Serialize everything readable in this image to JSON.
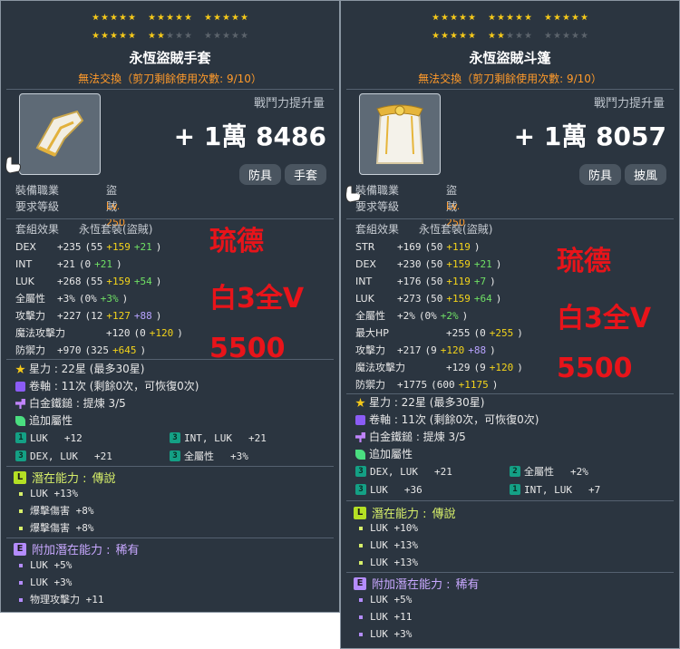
{
  "left": {
    "stars_on_row1": 15,
    "stars_on_row2": 7,
    "title": "永恆盜賊手套",
    "trade_note": "無法交換（剪刀剩餘使用次數: 9/10）",
    "power_label": "戰鬥力提升量",
    "power_value": "+ 1萬 8486",
    "tags": [
      "防具",
      "手套"
    ],
    "job_label": "裝備職業",
    "job_value": "盜賊",
    "level_label": "要求等級",
    "level_value": "Lv. 250",
    "set_label": "套組效果",
    "set_name": "永恆套裝(盜賊)",
    "stats": [
      {
        "name": "DEX",
        "base": "+235",
        "detail": "(55",
        "yel": "+159",
        "grn": "+21",
        "close": ")",
        "pur": ""
      },
      {
        "name": "INT",
        "base": "+21",
        "detail": "(0",
        "yel": "",
        "grn": "+21",
        "close": ")",
        "pur": ""
      },
      {
        "name": "LUK",
        "base": "+268",
        "detail": "(55",
        "yel": "+159",
        "grn": "+54",
        "close": ")",
        "pur": ""
      },
      {
        "name": "全屬性",
        "base": "+3%",
        "detail": "(0%",
        "yel": "",
        "grn": "+3%",
        "close": ")",
        "pur": ""
      },
      {
        "name": "攻擊力",
        "base": "+227",
        "detail": "(12",
        "yel": "+127",
        "grn": "",
        "close": ")",
        "pur": "+88"
      },
      {
        "name": "魔法攻擊力",
        "base": "+120",
        "detail": "(0",
        "yel": "+120",
        "grn": "",
        "close": ")",
        "pur": ""
      },
      {
        "name": "防禦力",
        "base": "+970",
        "detail": "(325",
        "yel": "+645",
        "grn": "",
        "close": ")",
        "pur": ""
      }
    ],
    "overlay": [
      "琉德",
      "白3全V",
      "5500"
    ],
    "star_force": "星力 : 22星 (最多30星)",
    "scroll": "卷軸 : 11次 (剩餘0次，可恢復0次)",
    "hammer": "白金鐵鎚 : 提煉 3/5",
    "flame_title": "追加屬性",
    "flames": [
      {
        "stat": "LUK",
        "val": "+12"
      },
      {
        "stat": "INT, LUK",
        "val": "+21"
      },
      {
        "stat": "DEX, LUK",
        "val": "+21"
      },
      {
        "stat": "全屬性",
        "val": "+3%"
      }
    ],
    "potential_label": "潛在能力 : ",
    "potential_grade": "傳說",
    "potential": [
      "LUK +13%",
      "爆擊傷害 +8%",
      "爆擊傷害 +8%"
    ],
    "bonus_label": "附加潛在能力 : ",
    "bonus_grade": "稀有",
    "bonus": [
      "LUK +5%",
      "LUK +3%",
      "物理攻擊力 +11"
    ],
    "icon_name": "glove-icon"
  },
  "right": {
    "stars_on_row1": 15,
    "stars_on_row2": 7,
    "title": "永恆盜賊斗篷",
    "trade_note": "無法交換（剪刀剩餘使用次數: 9/10）",
    "power_label": "戰鬥力提升量",
    "power_value": "+ 1萬 8057",
    "tags": [
      "防具",
      "披風"
    ],
    "job_label": "裝備職業",
    "job_value": "盜賊",
    "level_label": "要求等級",
    "level_value": "Lv. 250",
    "set_label": "套組效果",
    "set_name": "永恆套裝(盜賊)",
    "stats": [
      {
        "name": "STR",
        "base": "+169",
        "detail": "(50",
        "yel": "+119",
        "grn": "",
        "close": ")",
        "pur": ""
      },
      {
        "name": "DEX",
        "base": "+230",
        "detail": "(50",
        "yel": "+159",
        "grn": "+21",
        "close": ")",
        "pur": ""
      },
      {
        "name": "INT",
        "base": "+176",
        "detail": "(50",
        "yel": "+119",
        "grn": "+7",
        "close": ")",
        "pur": ""
      },
      {
        "name": "LUK",
        "base": "+273",
        "detail": "(50",
        "yel": "+159",
        "grn": "+64",
        "close": ")",
        "pur": ""
      },
      {
        "name": "全屬性",
        "base": "+2%",
        "detail": "(0%",
        "yel": "",
        "grn": "+2%",
        "close": ")",
        "pur": ""
      },
      {
        "name": "最大HP",
        "base": "+255",
        "detail": "(0",
        "yel": "+255",
        "grn": "",
        "close": ")",
        "pur": ""
      },
      {
        "name": "攻擊力",
        "base": "+217",
        "detail": "(9",
        "yel": "+120",
        "grn": "",
        "close": ")",
        "pur": "+88"
      },
      {
        "name": "魔法攻擊力",
        "base": "+129",
        "detail": "(9",
        "yel": "+120",
        "grn": "",
        "close": ")",
        "pur": ""
      },
      {
        "name": "防禦力",
        "base": "+1775",
        "detail": "(600",
        "yel": "+1175",
        "grn": "",
        "close": ")",
        "pur": ""
      }
    ],
    "overlay": [
      "琉德",
      "白3全V",
      "5500"
    ],
    "star_force": "星力 : 22星 (最多30星)",
    "scroll": "卷軸 : 11次 (剩餘0次，可恢復0次)",
    "hammer": "白金鐵鎚 : 提煉 3/5",
    "flame_title": "追加屬性",
    "flames": [
      {
        "stat": "DEX, LUK",
        "val": "+21"
      },
      {
        "stat": "全屬性",
        "val": "+2%"
      },
      {
        "stat": "LUK",
        "val": "+36"
      },
      {
        "stat": "INT, LUK",
        "val": "+7"
      }
    ],
    "potential_label": "潛在能力 : ",
    "potential_grade": "傳說",
    "potential": [
      "LUK +10%",
      "LUK +13%",
      "LUK +13%"
    ],
    "bonus_label": "附加潛在能力 : ",
    "bonus_grade": "稀有",
    "bonus": [
      "LUK +5%",
      "LUK +11",
      "LUK +3%"
    ],
    "icon_name": "cape-icon"
  },
  "colors": {
    "overlay_red": "#e8141a",
    "star_gold": "#f4c81a",
    "upgrade_yellow": "#f4d41a",
    "flame_green": "#6fe064"
  }
}
